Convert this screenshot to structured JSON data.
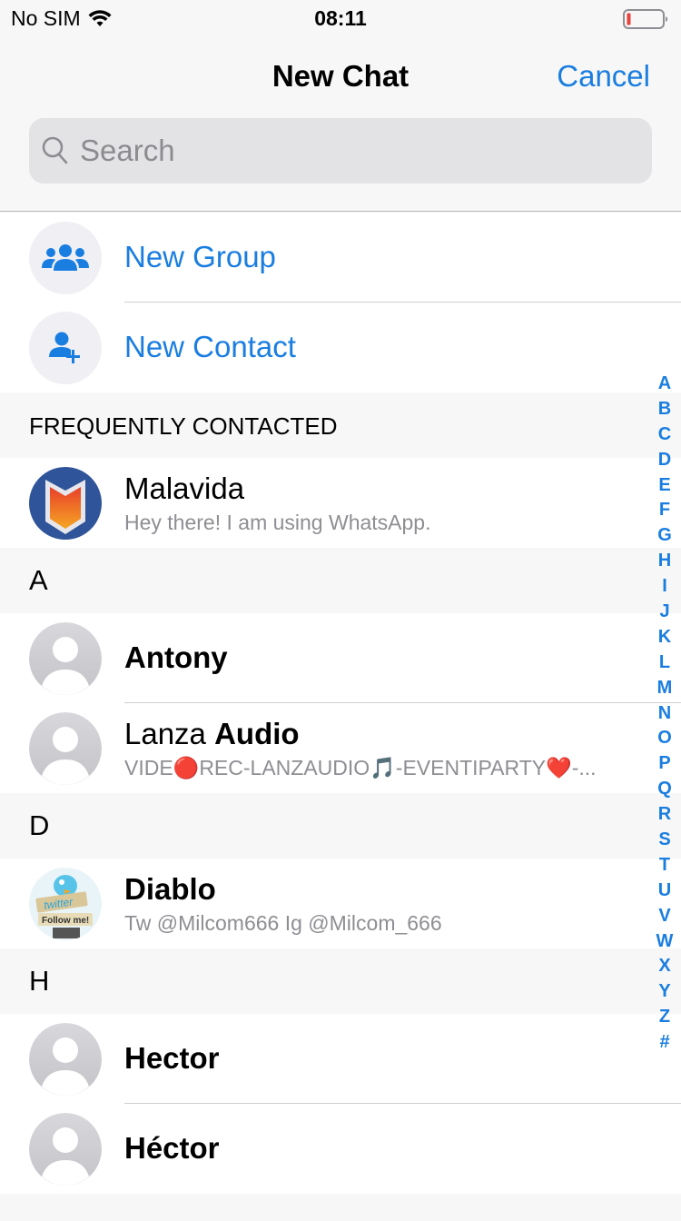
{
  "status_bar": {
    "carrier": "No SIM",
    "time": "08:11",
    "battery_color": "#e8423a"
  },
  "nav": {
    "title": "New Chat",
    "cancel_label": "Cancel"
  },
  "search": {
    "placeholder": "Search",
    "value": ""
  },
  "actions": [
    {
      "label": "New Group",
      "icon": "group-icon"
    },
    {
      "label": "New Contact",
      "icon": "add-contact-icon"
    }
  ],
  "sections": {
    "frequent": "FREQUENTLY CONTACTED",
    "a": "A",
    "d": "D",
    "h": "H"
  },
  "contacts": {
    "malavida": {
      "name": "Malavida",
      "status": "Hey there! I am using WhatsApp."
    },
    "antony": {
      "name": "Antony"
    },
    "lanza": {
      "name_first": "Lanza",
      "name_last": "Audio",
      "status": "VIDE🔴REC-LANZAUDIO🎵-EVENTIPARTY❤️-..."
    },
    "diablo": {
      "name": "Diablo",
      "status": "Tw @Milcom666 Ig @Milcom_666"
    },
    "hector": {
      "name": "Hector"
    },
    "hector2": {
      "name": "Héctor"
    }
  },
  "index_letters": [
    "A",
    "B",
    "C",
    "D",
    "E",
    "F",
    "G",
    "H",
    "I",
    "J",
    "K",
    "L",
    "M",
    "N",
    "O",
    "P",
    "Q",
    "R",
    "S",
    "T",
    "U",
    "V",
    "W",
    "X",
    "Y",
    "Z",
    "#"
  ],
  "colors": {
    "accent": "#1a7ee0",
    "secondary_text": "#8e8e93"
  }
}
